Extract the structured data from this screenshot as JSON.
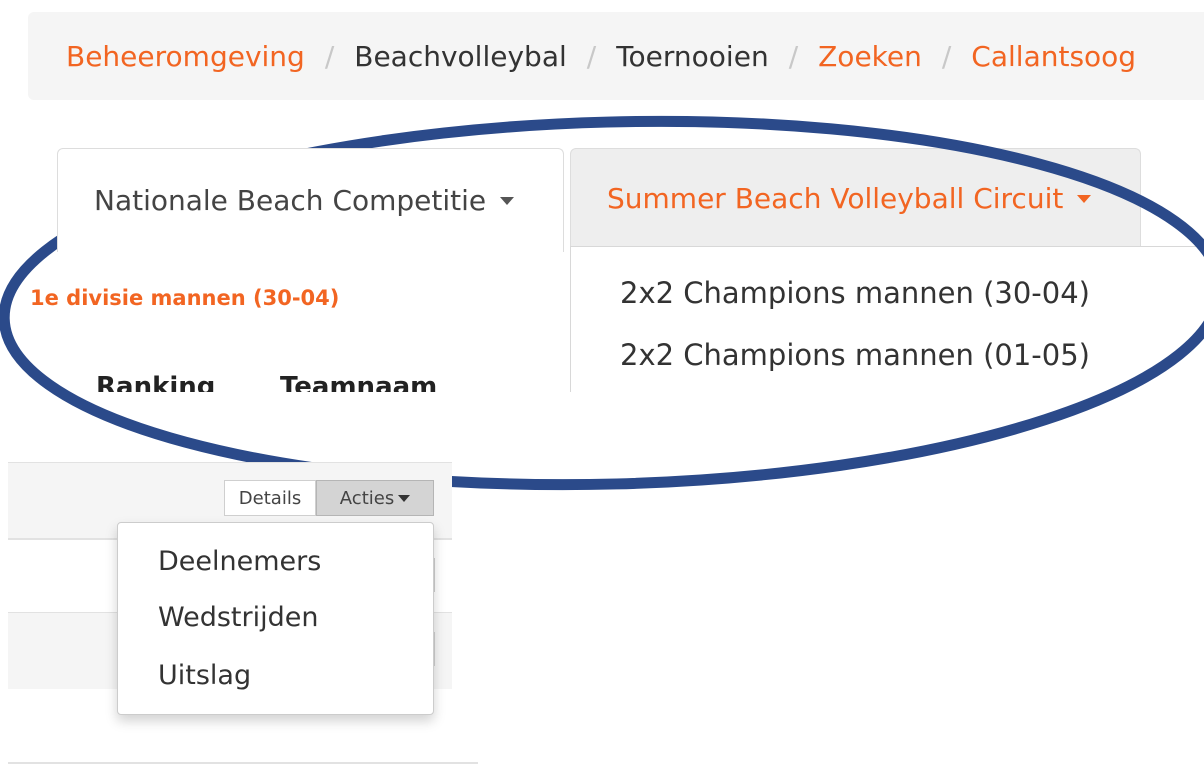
{
  "breadcrumb": {
    "items": [
      {
        "label": "Beheeromgeving"
      },
      {
        "label": "Beachvolleybal"
      },
      {
        "label": "Toernooien"
      },
      {
        "label": "Zoeken"
      },
      {
        "label": "Callantsoog"
      }
    ],
    "separator": "/"
  },
  "competition_tabs": [
    {
      "label": "Nationale Beach Competitie"
    },
    {
      "label": "Summer Beach Volleyball Circuit"
    }
  ],
  "competition_dropdown": {
    "items": [
      {
        "label": "2x2 Champions mannen (30-04)"
      },
      {
        "label": "2x2 Champions mannen (01-05)"
      }
    ]
  },
  "section": {
    "title": "1e divisie mannen (30-04)"
  },
  "table": {
    "headers": [
      "Ranking",
      "Teamnaam"
    ]
  },
  "row_actions": {
    "details_label": "Details",
    "acties_label": "Acties"
  },
  "acties_menu": {
    "items": [
      {
        "label": "Deelnemers"
      },
      {
        "label": "Wedstrijden"
      },
      {
        "label": "Uitslag"
      }
    ]
  },
  "colors": {
    "accent": "#f26522",
    "annotation_ellipse": "#2b4a8a"
  }
}
